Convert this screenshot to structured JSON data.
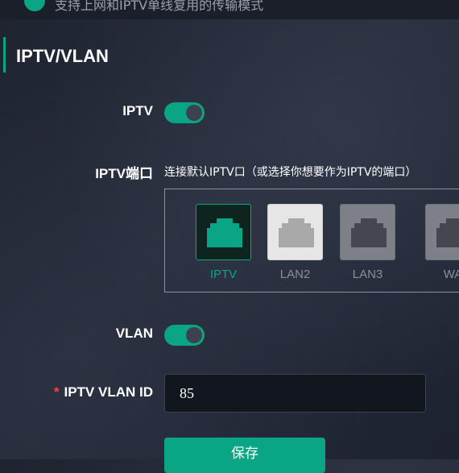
{
  "topbar": {
    "description": "支持上网和IPTV单线复用的传输模式"
  },
  "section": {
    "title": "IPTV/VLAN"
  },
  "iptv": {
    "label": "IPTV",
    "enabled": true
  },
  "iptv_port": {
    "label": "IPTV端口",
    "hint": "连接默认IPTV口（或选择你想要作为IPTV的端口）",
    "ports": [
      {
        "label": "IPTV",
        "state": "selected"
      },
      {
        "label": "LAN2",
        "state": "available"
      },
      {
        "label": "LAN3",
        "state": "disabled"
      },
      {
        "label": "WA",
        "state": "disabled"
      }
    ]
  },
  "vlan": {
    "label": "VLAN",
    "enabled": true
  },
  "iptv_vlan_id": {
    "label": "IPTV VLAN ID",
    "required_mark": "*",
    "value": "85"
  },
  "actions": {
    "save_label": "保存"
  },
  "colors": {
    "accent": "#0aa585",
    "required": "#ff3d3d"
  }
}
